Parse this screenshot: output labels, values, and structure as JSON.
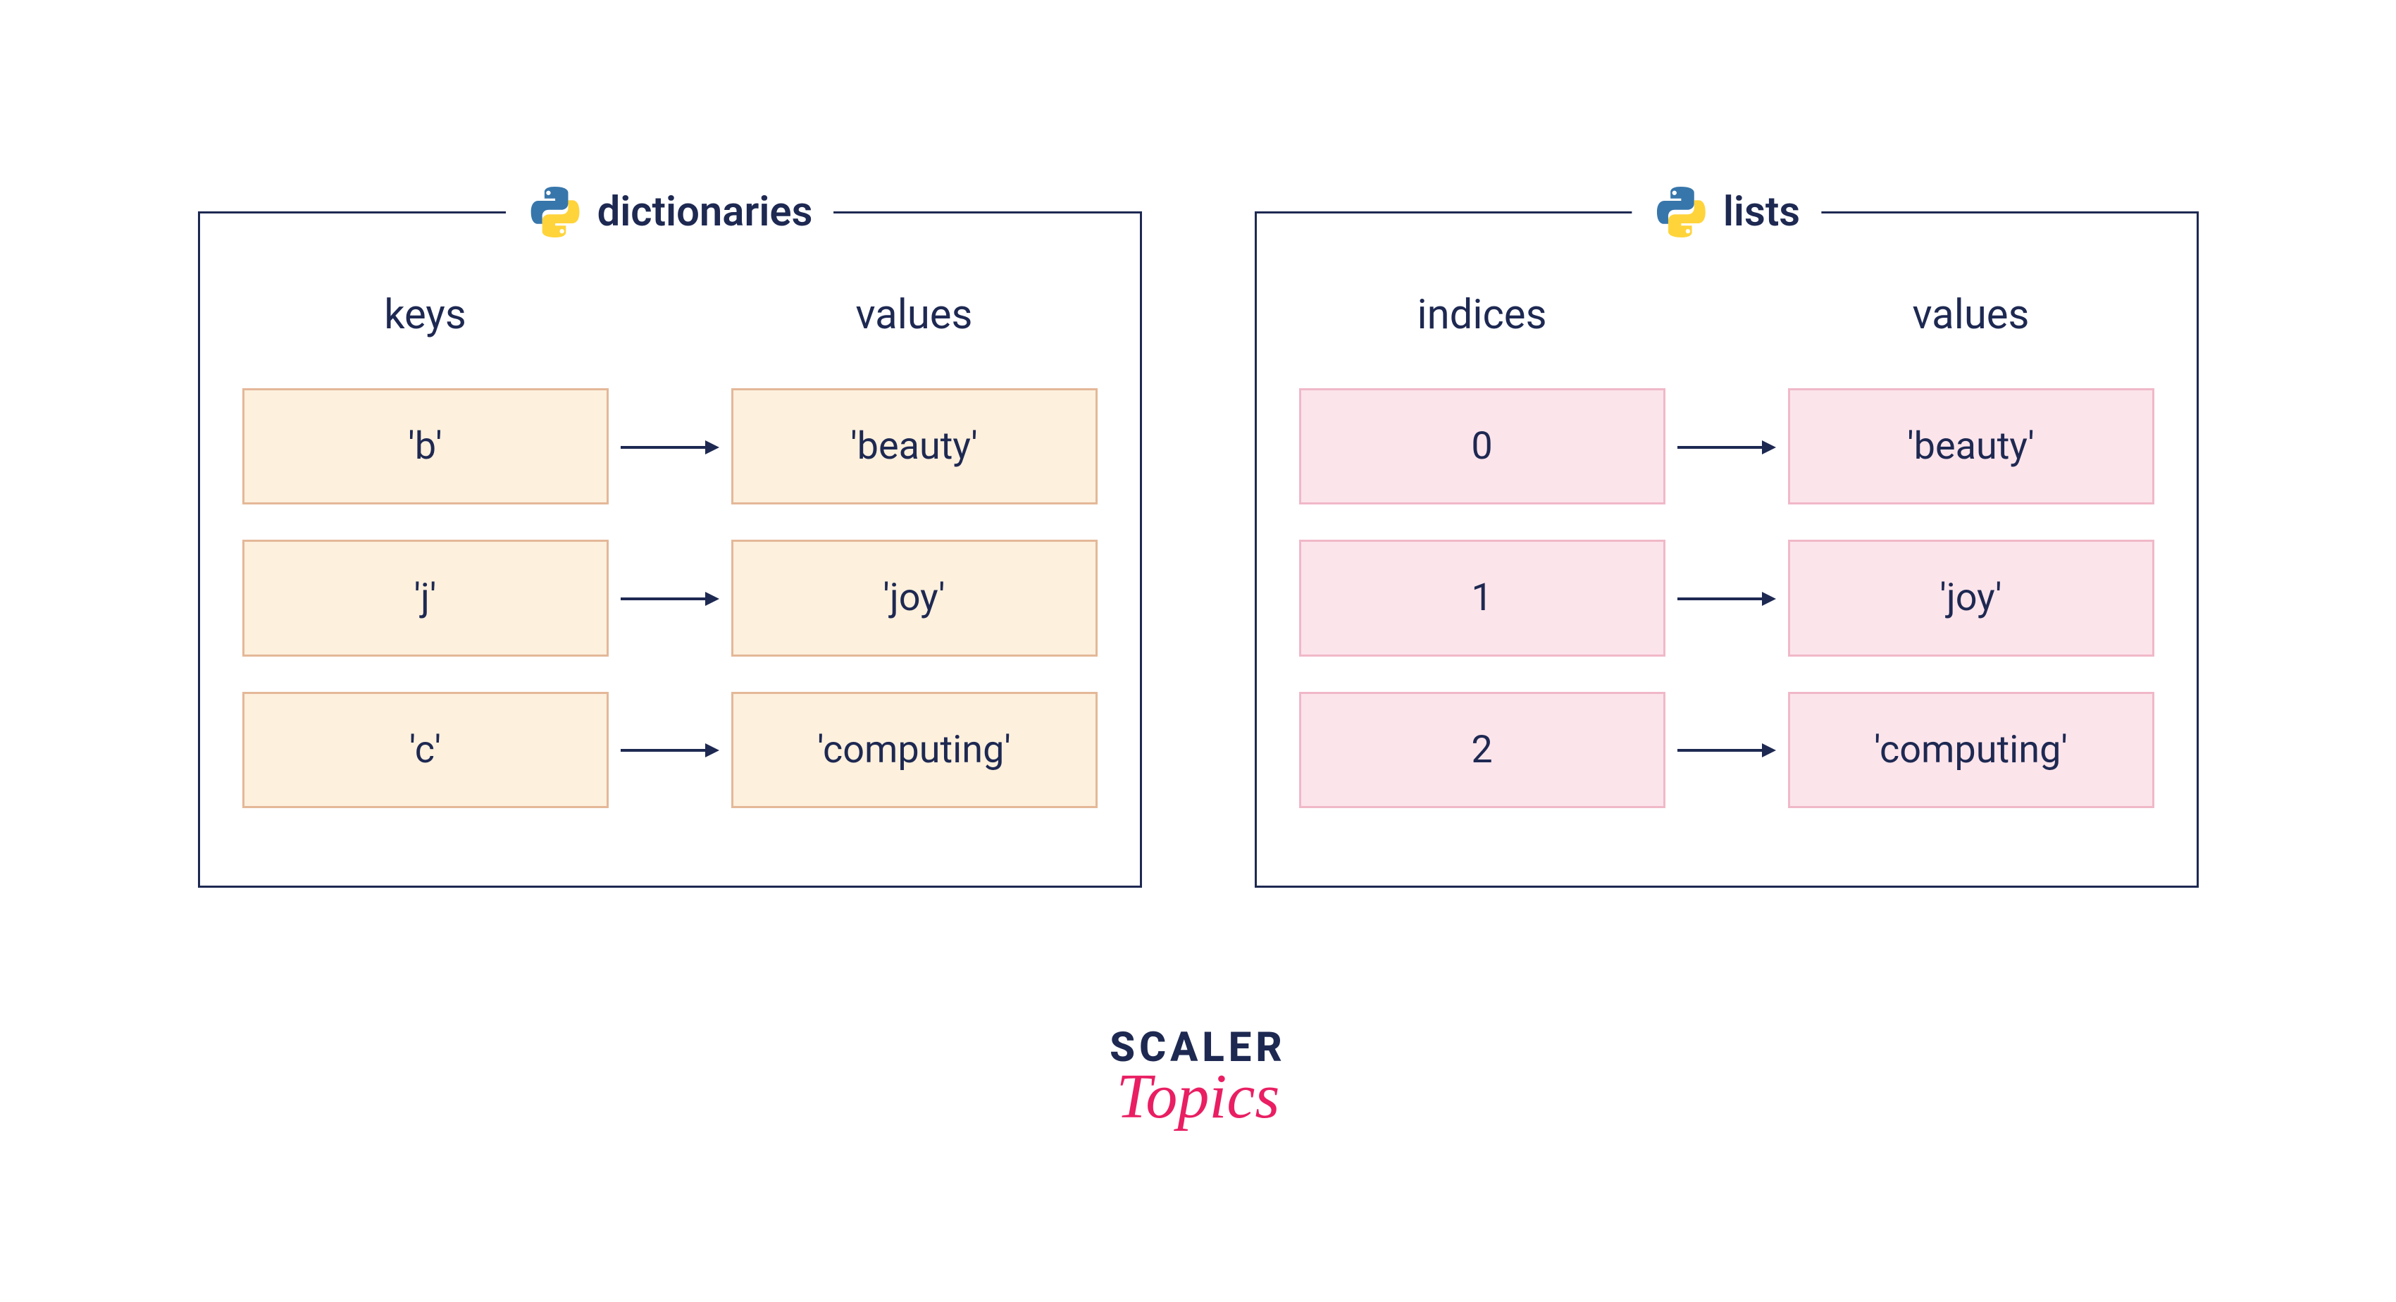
{
  "panels": {
    "dictionaries": {
      "title": "dictionaries",
      "leftHeader": "keys",
      "rightHeader": "values",
      "rows": [
        {
          "key": "'b'",
          "value": "'beauty'"
        },
        {
          "key": "'j'",
          "value": "'joy'"
        },
        {
          "key": "'c'",
          "value": "'computing'"
        }
      ]
    },
    "lists": {
      "title": "lists",
      "leftHeader": "indices",
      "rightHeader": "values",
      "rows": [
        {
          "index": "0",
          "value": "'beauty'"
        },
        {
          "index": "1",
          "value": "'joy'"
        },
        {
          "index": "2",
          "value": "'computing'"
        }
      ]
    }
  },
  "footer": {
    "brand": "SCALER",
    "subbrand": "Topics"
  }
}
